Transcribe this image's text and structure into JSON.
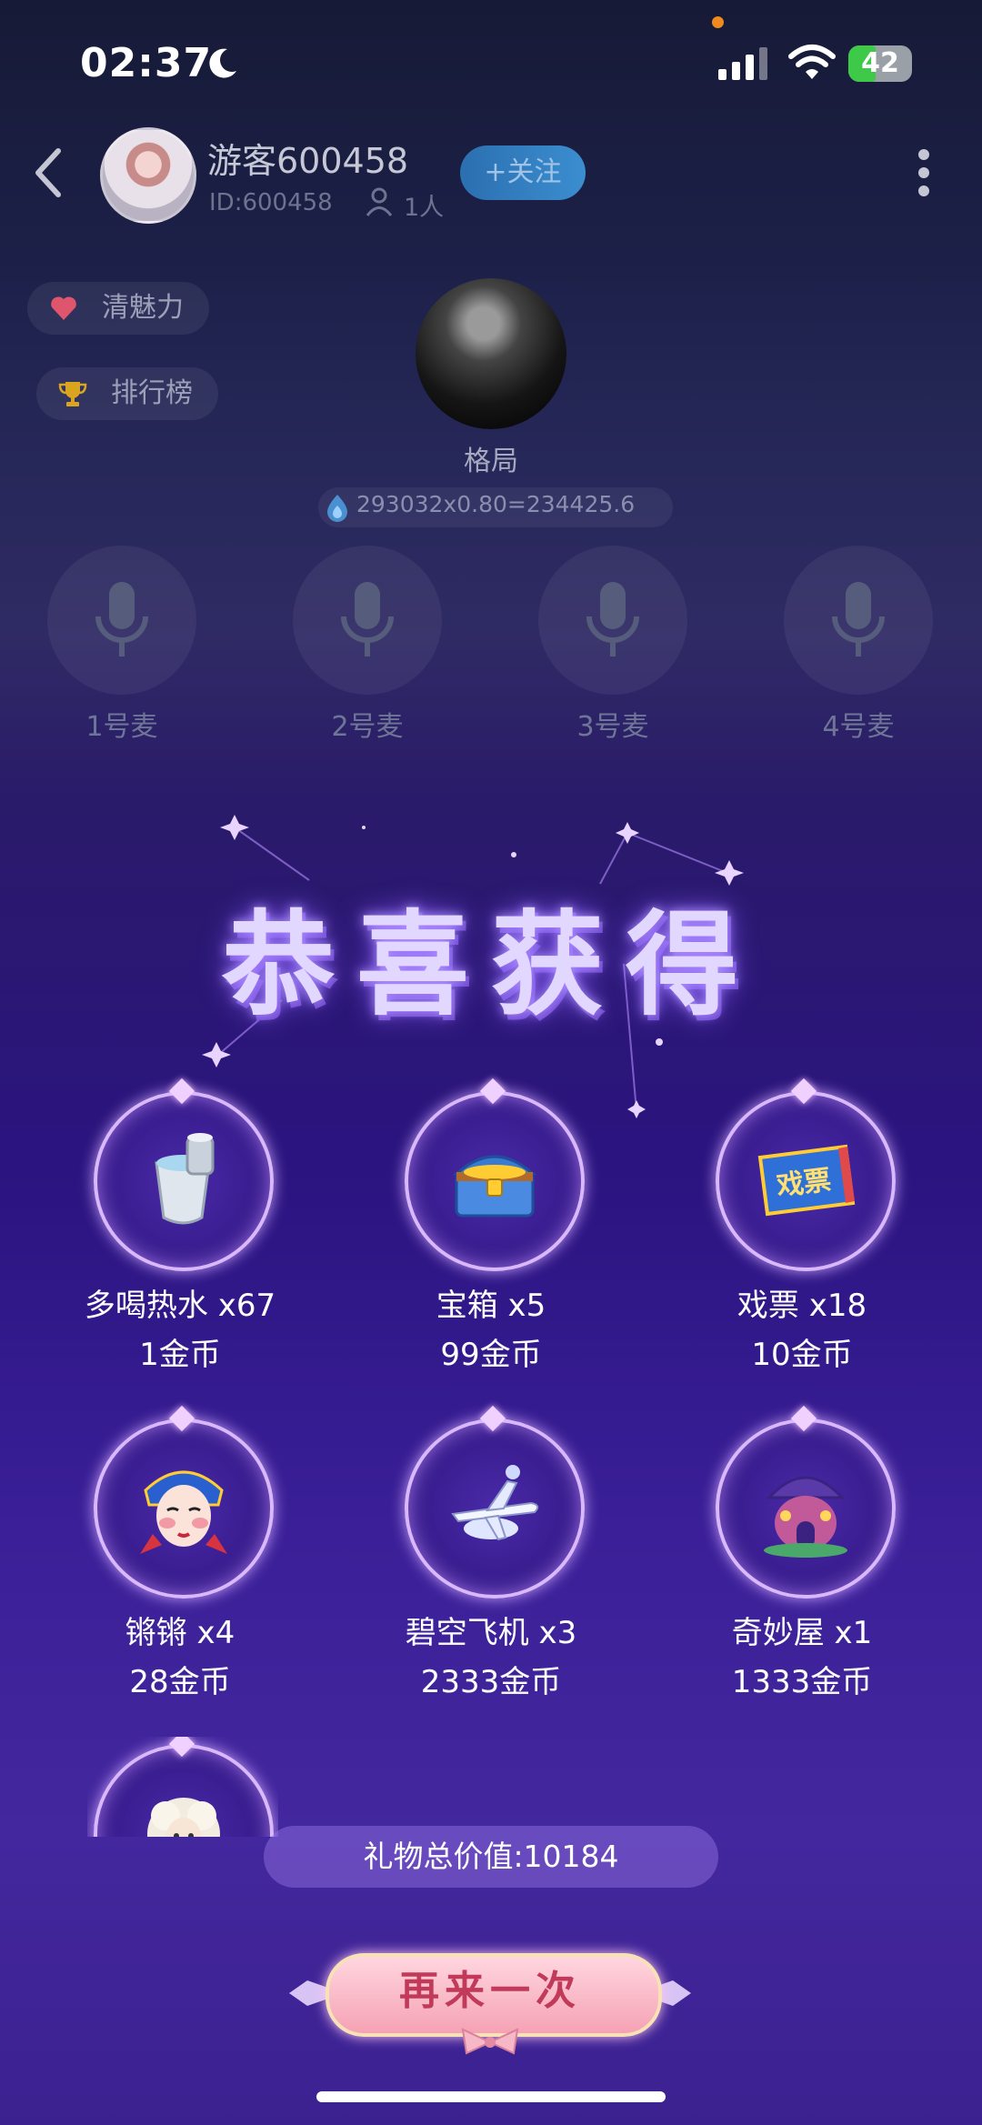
{
  "status_bar": {
    "time": "02:37",
    "battery": "42"
  },
  "room": {
    "host_name": "游客600458",
    "host_id": "ID:600458",
    "online_count": "1人",
    "follow_label": "+关注",
    "charm_label": "清魅力",
    "rank_label": "排行榜",
    "center_name": "格局",
    "formula": "293032x0.80=234425.6"
  },
  "mics": [
    "1号麦",
    "2号麦",
    "3号麦",
    "4号麦"
  ],
  "result": {
    "title": "恭喜获得",
    "gifts": [
      {
        "name": "多喝热水 x67",
        "value": "1金币",
        "icon": "thermos-icon"
      },
      {
        "name": "宝箱 x5",
        "value": "99金币",
        "icon": "treasure-chest-icon"
      },
      {
        "name": "戏票 x18",
        "value": "10金币",
        "icon": "opera-ticket-icon",
        "icon_text": "戏票"
      },
      {
        "name": "锵锵 x4",
        "value": "28金币",
        "icon": "opera-mask-icon"
      },
      {
        "name": "碧空飞机 x3",
        "value": "2333金币",
        "icon": "airplane-icon"
      },
      {
        "name": "奇妙屋 x1",
        "value": "1333金币",
        "icon": "magic-house-icon"
      },
      {
        "name": "",
        "value": "",
        "icon": "sheep-icon"
      }
    ],
    "total_label": "礼物总价值:10184",
    "again_label": "再来一次"
  },
  "colors": {
    "accent": "#8a5cff",
    "follow": "#3b8ed0",
    "again_text": "#c23a5a"
  }
}
